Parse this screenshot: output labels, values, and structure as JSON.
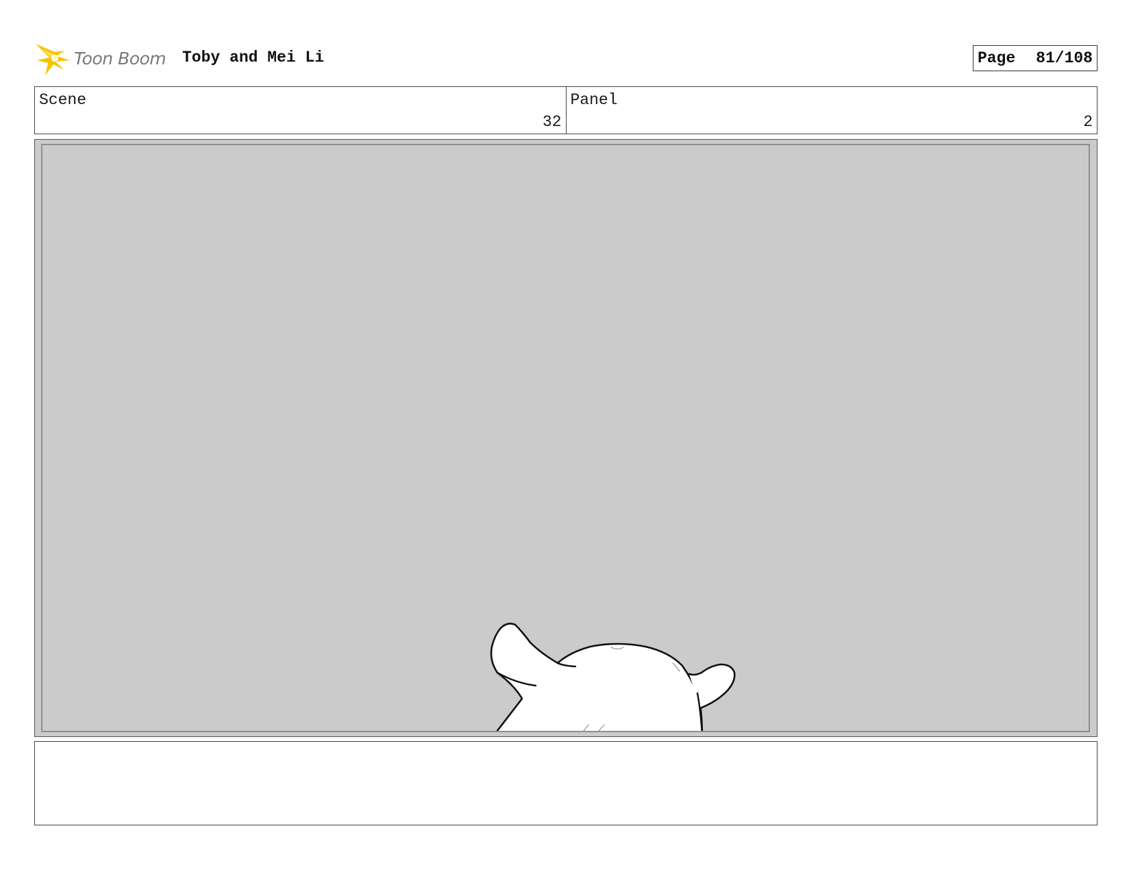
{
  "header": {
    "logo_text": "Toon Boom",
    "title": "Toby and Mei Li",
    "page_label": "Page",
    "page_value": "81/108"
  },
  "info": {
    "scene_label": "Scene",
    "scene_value": "32",
    "panel_label": "Panel",
    "panel_value": "2"
  },
  "notes": {
    "text": ""
  },
  "colors": {
    "logo_star": "#f5c400",
    "frame_fill": "#cbcbcb",
    "sketch_line": "#111111"
  }
}
